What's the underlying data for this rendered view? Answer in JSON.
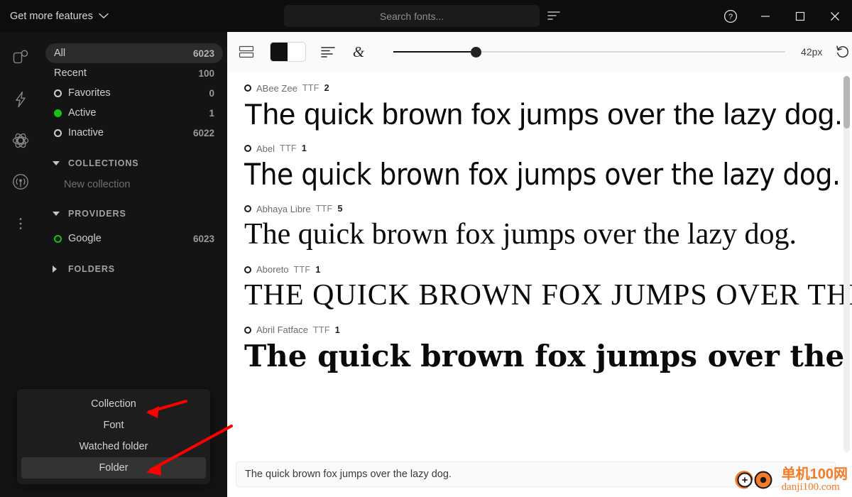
{
  "titlebar": {
    "get_more_features": "Get more features",
    "chevron_icon": "chevron-down-icon",
    "sort_icon": "sort-icon",
    "help_icon": "help-circle-icon",
    "minimize_icon": "minimize-icon",
    "maximize_icon": "maximize-icon",
    "close_icon": "close-icon"
  },
  "search": {
    "placeholder": "Search fonts...",
    "value": ""
  },
  "rail": {
    "items": [
      {
        "icon": "library-badge-icon",
        "name": "rail-library"
      },
      {
        "icon": "lightning-bolt-icon",
        "name": "rail-activation"
      },
      {
        "icon": "atom-icon",
        "name": "rail-plugins"
      },
      {
        "icon": "broadcast-icon",
        "name": "rail-sync"
      },
      {
        "icon": "more-vertical-icon",
        "name": "rail-more"
      }
    ]
  },
  "sidebar": {
    "filters": [
      {
        "label": "All",
        "count": "6023",
        "dot": "none",
        "selected": true
      },
      {
        "label": "Recent",
        "count": "100",
        "dot": "none",
        "selected": false
      },
      {
        "label": "Favorites",
        "count": "0",
        "dot": "hollow",
        "selected": false
      },
      {
        "label": "Active",
        "count": "1",
        "dot": "filled",
        "selected": false
      },
      {
        "label": "Inactive",
        "count": "6022",
        "dot": "hollow",
        "selected": false
      }
    ],
    "collections": {
      "title": "COLLECTIONS",
      "expanded": true,
      "new_collection": "New collection"
    },
    "providers": {
      "title": "PROVIDERS",
      "expanded": true,
      "items": [
        {
          "label": "Google",
          "count": "6023",
          "dot": "green-ring"
        }
      ]
    },
    "folders": {
      "title": "FOLDERS",
      "expanded": false
    }
  },
  "context_menu": {
    "items": [
      {
        "label": "Collection",
        "selected": false
      },
      {
        "label": "Font",
        "selected": false
      },
      {
        "label": "Watched folder",
        "selected": false
      },
      {
        "label": "Folder",
        "selected": true
      }
    ]
  },
  "toolbar": {
    "view_list_icon": "list-view-icon",
    "contrast_toggle_icon": "black-white-toggle-icon",
    "align_icon": "text-align-left-icon",
    "glyph_icon": "ampersand-glyph-icon",
    "size_value": "42px",
    "slider_percent": 21,
    "reset_icon": "reset-circular-arrow-icon"
  },
  "font_list": {
    "rows": [
      {
        "name": "ABee Zee",
        "format": "TTF",
        "styles": "2",
        "sample": "The quick brown fox jumps over the lazy dog.",
        "style_class": "s-abeezee"
      },
      {
        "name": "Abel",
        "format": "TTF",
        "styles": "1",
        "sample": "The quick brown fox jumps over the lazy dog.",
        "style_class": "s-abel"
      },
      {
        "name": "Abhaya Libre",
        "format": "TTF",
        "styles": "5",
        "sample": "The quick brown fox jumps over the lazy dog.",
        "style_class": "s-abhaya"
      },
      {
        "name": "Aboreto",
        "format": "TTF",
        "styles": "1",
        "sample": "The quick brown fox jumps over the lazy dog.",
        "style_class": "s-aboreto"
      },
      {
        "name": "Abril Fatface",
        "format": "TTF",
        "styles": "1",
        "sample": "The quick brown fox jumps over the lazy dog.",
        "style_class": "s-abrilfatface"
      }
    ]
  },
  "sample_input": {
    "value": "The quick brown fox jumps over the lazy dog."
  },
  "watermark": {
    "cn": "单机100网",
    "en": "danji100.com",
    "color": "#f47b28"
  },
  "annotation": {
    "color": "#ff0000",
    "arrow_count": 2
  },
  "colors": {
    "chrome_dark": "#0d0d0d",
    "panel_dark": "#141414",
    "selected_row": "#2b2b2b",
    "accent_green": "#17c217",
    "main_bg": "#ffffff",
    "toolbar_bg": "#fafafa"
  }
}
